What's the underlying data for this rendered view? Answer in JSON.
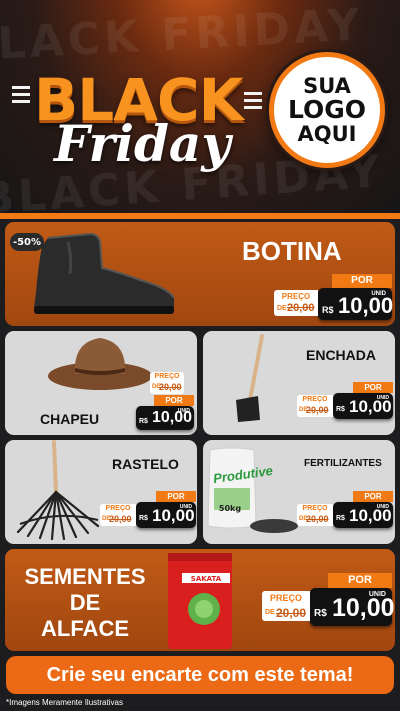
{
  "header": {
    "background_word": "BLACK FRIDAY",
    "logo_top": "BLACK",
    "logo_bottom": "Friday",
    "logo_placeholder": {
      "line1": "SUA",
      "line2": "LOGO",
      "line3": "AQUI"
    }
  },
  "colors": {
    "accent": "#f27a15",
    "card_dark": "#a04710",
    "card_light": "#d9d9d9",
    "price_box": "#111111"
  },
  "products": [
    {
      "name": "BOTINA",
      "discount": "-50%",
      "icon": "boot-icon",
      "price": {
        "old_label": "PREÇO",
        "old_prefix": "DE",
        "old_value": "20,00",
        "new_label": "POR",
        "currency": "R$",
        "new_value": "10,00",
        "unit": "UNID"
      }
    },
    {
      "name": "CHAPEU",
      "icon": "hat-icon",
      "price": {
        "old_label": "PREÇO",
        "old_prefix": "DE",
        "old_value": "20,00",
        "new_label": "POR",
        "currency": "R$",
        "new_value": "10,00",
        "unit": "UNID"
      }
    },
    {
      "name": "ENCHADA",
      "icon": "hoe-icon",
      "price": {
        "old_label": "PREÇO",
        "old_prefix": "DE",
        "old_value": "20,00",
        "new_label": "POR",
        "currency": "R$",
        "new_value": "10,00",
        "unit": "UNID"
      }
    },
    {
      "name": "RASTELO",
      "icon": "rake-icon",
      "price": {
        "old_label": "PREÇO",
        "old_prefix": "DE",
        "old_value": "20,00",
        "new_label": "POR",
        "currency": "R$",
        "new_value": "10,00",
        "unit": "UNID"
      }
    },
    {
      "name": "FERTILIZANTES",
      "icon": "fertilizer-bag-icon",
      "bag_brand": "Produtive",
      "bag_weight": "50kg",
      "price": {
        "old_label": "PREÇO",
        "old_prefix": "DE",
        "old_value": "20,00",
        "new_label": "POR",
        "currency": "R$",
        "new_value": "10,00",
        "unit": "UNID"
      }
    },
    {
      "name_lines": [
        "SEMENTES",
        "DE",
        "ALFACE"
      ],
      "icon": "seed-packet-icon",
      "packet_brand": "SAKATA",
      "price": {
        "old_label": "PREÇO",
        "old_prefix": "DE",
        "old_value": "20,00",
        "new_label": "POR",
        "currency": "R$",
        "new_value": "10,00",
        "unit": "UNID"
      }
    }
  ],
  "footer": {
    "cta": "Crie seu encarte com este tema!",
    "disclaimer": "*Imagens Meramente Ilustrativas"
  }
}
